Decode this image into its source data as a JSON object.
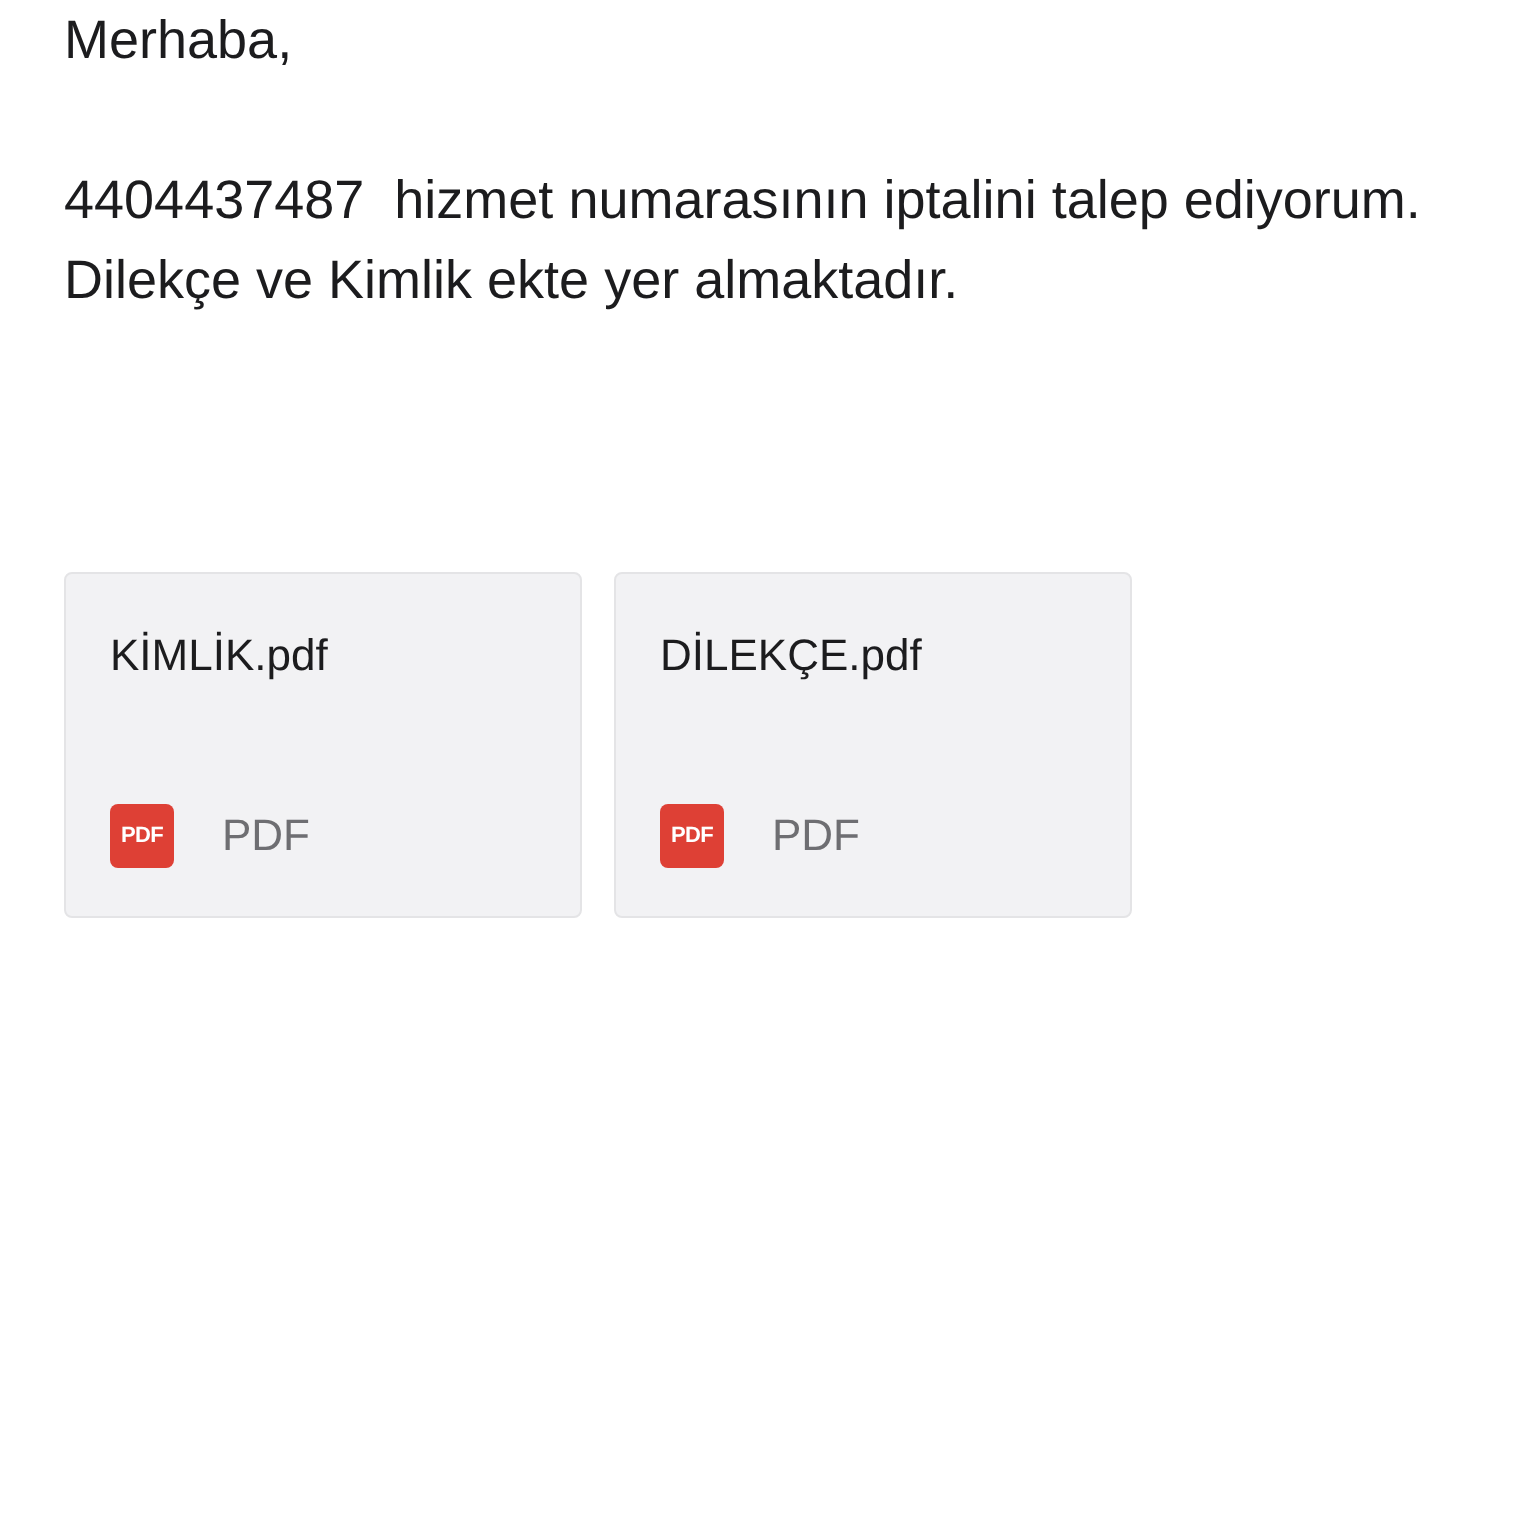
{
  "greeting": "Merhaba,",
  "body": "4404437487  hizmet numarasının iptalini talep ediyorum. Dilekçe ve Kimlik ekte yer almaktadır.",
  "attachments": [
    {
      "name": "KİMLİK.pdf",
      "icon_text": "PDF",
      "type": "PDF"
    },
    {
      "name": "DİLEKÇE.pdf",
      "icon_text": "PDF",
      "type": "PDF"
    }
  ]
}
